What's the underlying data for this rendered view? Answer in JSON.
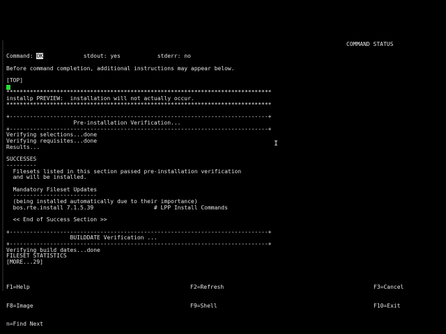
{
  "screen_title": "COMMAND STATUS",
  "status": {
    "command_label": "Command:",
    "command_value": "OK",
    "stdout_label": "stdout:",
    "stdout_value": "yes",
    "stderr_label": "stderr:",
    "stderr_value": "no"
  },
  "notice": "Before command completion, additional instructions may appear below.",
  "output_lines": [
    "[TOP]",
    "",
    "*******************************************************************************",
    "installp PREVIEW:  installation will not actually occur.",
    "*******************************************************************************",
    "",
    "+-----------------------------------------------------------------------------+",
    "                    Pre-installation Verification...",
    "+-----------------------------------------------------------------------------+",
    "Verifying selections...done",
    "Verifying requisites...done",
    "Results...",
    "",
    "SUCCESSES",
    "---------",
    "  Filesets listed in this section passed pre-installation verification",
    "  and will be installed.",
    "",
    "  Mandatory Fileset Updates",
    "  -------------------------",
    "  (being installed automatically due to their importance)",
    "  bos.rte.install 7.1.5.39                  # LPP Install Commands",
    "",
    "  << End of Success Section >>",
    "",
    "+-----------------------------------------------------------------------------+",
    "                   BUILDDATE Verification ...",
    "+-----------------------------------------------------------------------------+",
    "Verifying build dates...done",
    "FILESET STATISTICS",
    "[MORE...29]"
  ],
  "function_keys": {
    "col1": [
      "F1=Help",
      "F8=Image",
      "n=Find Next"
    ],
    "col2": [
      "F2=Refresh",
      "F9=Shell"
    ],
    "col3": [
      "F3=Cancel",
      "F10=Exit"
    ]
  },
  "colors": {
    "background": "#000000",
    "text": "#e4e4e4",
    "cursor": "#2bdc3a"
  }
}
